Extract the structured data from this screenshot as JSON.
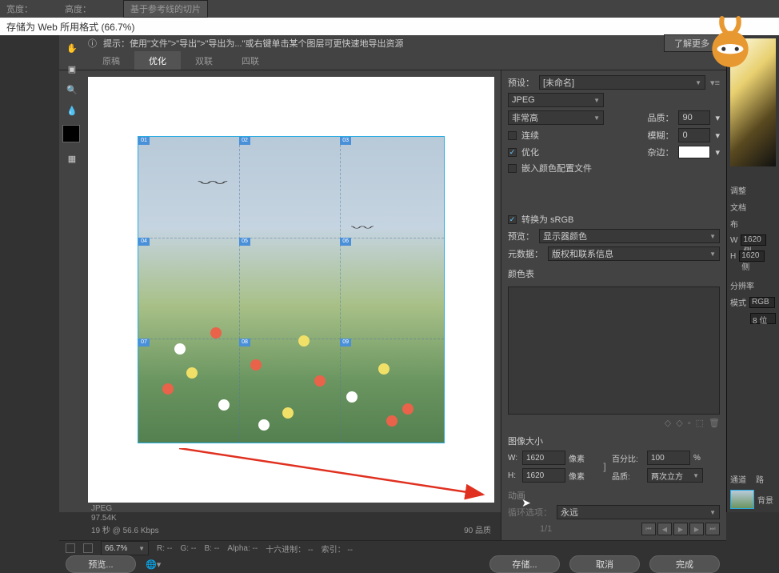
{
  "topbar": {
    "width_lbl": "宽度：",
    "height_lbl": "高度：",
    "slice_btn": "基于参考线的切片"
  },
  "title": "存储为 Web 所用格式 (66.7%)",
  "hint": {
    "icon": "ⓘ",
    "text": "提示：使用\"文件\">\"导出\">\"导出为...\"或右键单击某个图层可更快速地导出资源",
    "learn": "了解更多"
  },
  "tabs": {
    "a": "原稿",
    "b": "优化",
    "c": "双联",
    "d": "四联"
  },
  "preview_status": {
    "fmt": "JPEG",
    "size": "97.54K",
    "speed": "19 秒 @ 56.6 Kbps",
    "quality": "90 品质"
  },
  "preset": {
    "lbl": "预设：",
    "val": "[未命名]"
  },
  "fmt_sel": "JPEG",
  "quality_row": {
    "left": "非常高",
    "qual_lbl": "品质：",
    "qual_val": "90"
  },
  "checks": {
    "prog": "连续",
    "opt": "优化",
    "icc": "嵌入颜色配置文件"
  },
  "blur": {
    "lbl": "模糊：",
    "val": "0"
  },
  "matte": {
    "lbl": "杂边："
  },
  "srgb": {
    "cb": "转换为 sRGB",
    "preview_lbl": "预览：",
    "preview_val": "显示器颜色",
    "meta_lbl": "元数据：",
    "meta_val": "版权和联系信息"
  },
  "colortable_lbl": "颜色表",
  "imgsize": {
    "h": "图像大小",
    "w_lbl": "W:",
    "w": "1620",
    "h_lbl": "H:",
    "hh": "1620",
    "px": "像素",
    "pct_lbl": "百分比:",
    "pct": "100",
    "pct_unit": "%",
    "q_lbl": "品质:",
    "q": "两次立方"
  },
  "anim": {
    "h": "动画",
    "loop_lbl": "循环选项：",
    "loop_val": "永远",
    "frame": "1/1"
  },
  "botbar": {
    "zoom": "66.7%",
    "r": "R:",
    "g": "G:",
    "b": "B:",
    "dash": "--",
    "alpha": "Alpha:",
    "hex": "十六进制：",
    "idx": "索引："
  },
  "footer": {
    "preview": "预览...",
    "save": "存储...",
    "cancel": "取消",
    "done": "完成"
  },
  "rpanel": {
    "adj": "调整",
    "doc": "文档",
    "canvas": "布",
    "wl": "W",
    "hl": "H",
    "wv": "1620 侧",
    "hv": "1620 侧",
    "res": "分辨率",
    "mode_l": "模式",
    "mode_v": "RGB",
    "bits": "8 位",
    "ch": "通道",
    "path": "路",
    "bg": "背景"
  }
}
